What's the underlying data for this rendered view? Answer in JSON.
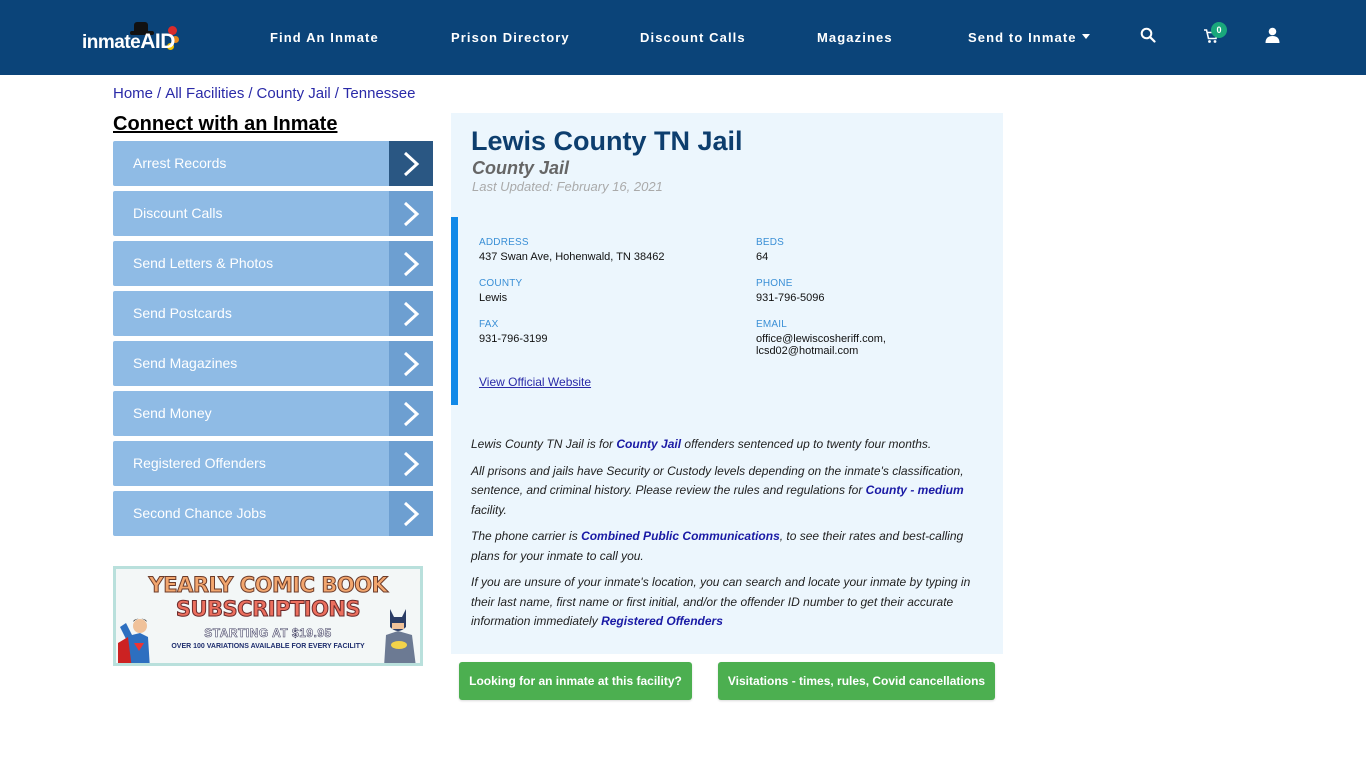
{
  "header": {
    "logo_text_main": "inmate",
    "logo_text_accent": "AID",
    "nav": [
      {
        "label": "Find An Inmate"
      },
      {
        "label": "Prison Directory"
      },
      {
        "label": "Discount Calls"
      },
      {
        "label": "Magazines"
      },
      {
        "label": "Send to Inmate",
        "has_dropdown": true
      }
    ],
    "icons": [
      "search-icon",
      "cart-icon",
      "user-icon"
    ],
    "cart_count": "0",
    "colors": {
      "bar": "#0b4479",
      "badge": "#1aa87b"
    }
  },
  "breadcrumb": [
    {
      "label": "Home"
    },
    {
      "label": "All Facilities"
    },
    {
      "label": "County Jail"
    },
    {
      "label": "Tennessee"
    }
  ],
  "sidebar": {
    "title": "Connect with an Inmate",
    "items": [
      {
        "label": "Arrest Records"
      },
      {
        "label": "Discount Calls"
      },
      {
        "label": "Send Letters & Photos"
      },
      {
        "label": "Send Postcards"
      },
      {
        "label": "Send Magazines"
      },
      {
        "label": "Send Money"
      },
      {
        "label": "Registered Offenders"
      },
      {
        "label": "Second Chance Jobs"
      }
    ],
    "promo": {
      "line1": "YEARLY COMIC BOOK",
      "line2": "SUBSCRIPTIONS",
      "line3": "STARTING AT $19.95",
      "line4": "OVER 100 VARIATIONS AVAILABLE FOR EVERY FACILITY"
    }
  },
  "facility": {
    "name": "Lewis County TN Jail",
    "type": "County Jail",
    "last_updated": "Last Updated: February 16, 2021",
    "fields": {
      "address": {
        "label": "ADDRESS",
        "value": "437 Swan Ave, Hohenwald, TN 38462"
      },
      "beds": {
        "label": "BEDS",
        "value": "64"
      },
      "county": {
        "label": "COUNTY",
        "value": "Lewis"
      },
      "phone": {
        "label": "PHONE",
        "value": "931-796-5096"
      },
      "fax": {
        "label": "FAX",
        "value": "931-796-3199"
      },
      "email": {
        "label": "EMAIL",
        "value_line1": "office@lewiscosheriff.com,",
        "value_line2": "lcsd02@hotmail.com"
      }
    },
    "official_website_label": "View Official Website",
    "description": {
      "p1_pre": "Lewis County TN Jail is for ",
      "p1_link": "County Jail",
      "p1_post": " offenders sentenced up to twenty four months.",
      "p2_pre": "All prisons and jails have Security or Custody levels depending on the inmate's classification, sentence, and criminal history. Please review the rules and regulations for ",
      "p2_link": "County - medium",
      "p2_post": " facility.",
      "p3_pre": "The phone carrier is ",
      "p3_link": "Combined Public Communications",
      "p3_post": ", to see their rates and best-calling plans for your inmate to call you.",
      "p4_pre": "If you are unsure of your inmate's location, you can search and locate your inmate by typing in their last name, first name or first initial, and/or the offender ID number to get their accurate information immediately ",
      "p4_link": "Registered Offenders"
    }
  },
  "actions": {
    "find_inmate": "Looking for an inmate at this facility?",
    "visitations": "Visitations - times, rules, Covid cancellations"
  }
}
